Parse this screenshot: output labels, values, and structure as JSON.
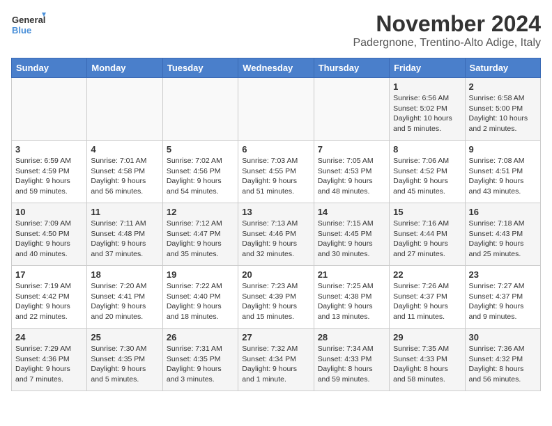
{
  "logo": {
    "line1": "General",
    "line2": "Blue"
  },
  "title": "November 2024",
  "location": "Padergnone, Trentino-Alto Adige, Italy",
  "days_of_week": [
    "Sunday",
    "Monday",
    "Tuesday",
    "Wednesday",
    "Thursday",
    "Friday",
    "Saturday"
  ],
  "weeks": [
    [
      {
        "day": "",
        "info": ""
      },
      {
        "day": "",
        "info": ""
      },
      {
        "day": "",
        "info": ""
      },
      {
        "day": "",
        "info": ""
      },
      {
        "day": "",
        "info": ""
      },
      {
        "day": "1",
        "info": "Sunrise: 6:56 AM\nSunset: 5:02 PM\nDaylight: 10 hours and 5 minutes."
      },
      {
        "day": "2",
        "info": "Sunrise: 6:58 AM\nSunset: 5:00 PM\nDaylight: 10 hours and 2 minutes."
      }
    ],
    [
      {
        "day": "3",
        "info": "Sunrise: 6:59 AM\nSunset: 4:59 PM\nDaylight: 9 hours and 59 minutes."
      },
      {
        "day": "4",
        "info": "Sunrise: 7:01 AM\nSunset: 4:58 PM\nDaylight: 9 hours and 56 minutes."
      },
      {
        "day": "5",
        "info": "Sunrise: 7:02 AM\nSunset: 4:56 PM\nDaylight: 9 hours and 54 minutes."
      },
      {
        "day": "6",
        "info": "Sunrise: 7:03 AM\nSunset: 4:55 PM\nDaylight: 9 hours and 51 minutes."
      },
      {
        "day": "7",
        "info": "Sunrise: 7:05 AM\nSunset: 4:53 PM\nDaylight: 9 hours and 48 minutes."
      },
      {
        "day": "8",
        "info": "Sunrise: 7:06 AM\nSunset: 4:52 PM\nDaylight: 9 hours and 45 minutes."
      },
      {
        "day": "9",
        "info": "Sunrise: 7:08 AM\nSunset: 4:51 PM\nDaylight: 9 hours and 43 minutes."
      }
    ],
    [
      {
        "day": "10",
        "info": "Sunrise: 7:09 AM\nSunset: 4:50 PM\nDaylight: 9 hours and 40 minutes."
      },
      {
        "day": "11",
        "info": "Sunrise: 7:11 AM\nSunset: 4:48 PM\nDaylight: 9 hours and 37 minutes."
      },
      {
        "day": "12",
        "info": "Sunrise: 7:12 AM\nSunset: 4:47 PM\nDaylight: 9 hours and 35 minutes."
      },
      {
        "day": "13",
        "info": "Sunrise: 7:13 AM\nSunset: 4:46 PM\nDaylight: 9 hours and 32 minutes."
      },
      {
        "day": "14",
        "info": "Sunrise: 7:15 AM\nSunset: 4:45 PM\nDaylight: 9 hours and 30 minutes."
      },
      {
        "day": "15",
        "info": "Sunrise: 7:16 AM\nSunset: 4:44 PM\nDaylight: 9 hours and 27 minutes."
      },
      {
        "day": "16",
        "info": "Sunrise: 7:18 AM\nSunset: 4:43 PM\nDaylight: 9 hours and 25 minutes."
      }
    ],
    [
      {
        "day": "17",
        "info": "Sunrise: 7:19 AM\nSunset: 4:42 PM\nDaylight: 9 hours and 22 minutes."
      },
      {
        "day": "18",
        "info": "Sunrise: 7:20 AM\nSunset: 4:41 PM\nDaylight: 9 hours and 20 minutes."
      },
      {
        "day": "19",
        "info": "Sunrise: 7:22 AM\nSunset: 4:40 PM\nDaylight: 9 hours and 18 minutes."
      },
      {
        "day": "20",
        "info": "Sunrise: 7:23 AM\nSunset: 4:39 PM\nDaylight: 9 hours and 15 minutes."
      },
      {
        "day": "21",
        "info": "Sunrise: 7:25 AM\nSunset: 4:38 PM\nDaylight: 9 hours and 13 minutes."
      },
      {
        "day": "22",
        "info": "Sunrise: 7:26 AM\nSunset: 4:37 PM\nDaylight: 9 hours and 11 minutes."
      },
      {
        "day": "23",
        "info": "Sunrise: 7:27 AM\nSunset: 4:37 PM\nDaylight: 9 hours and 9 minutes."
      }
    ],
    [
      {
        "day": "24",
        "info": "Sunrise: 7:29 AM\nSunset: 4:36 PM\nDaylight: 9 hours and 7 minutes."
      },
      {
        "day": "25",
        "info": "Sunrise: 7:30 AM\nSunset: 4:35 PM\nDaylight: 9 hours and 5 minutes."
      },
      {
        "day": "26",
        "info": "Sunrise: 7:31 AM\nSunset: 4:35 PM\nDaylight: 9 hours and 3 minutes."
      },
      {
        "day": "27",
        "info": "Sunrise: 7:32 AM\nSunset: 4:34 PM\nDaylight: 9 hours and 1 minute."
      },
      {
        "day": "28",
        "info": "Sunrise: 7:34 AM\nSunset: 4:33 PM\nDaylight: 8 hours and 59 minutes."
      },
      {
        "day": "29",
        "info": "Sunrise: 7:35 AM\nSunset: 4:33 PM\nDaylight: 8 hours and 58 minutes."
      },
      {
        "day": "30",
        "info": "Sunrise: 7:36 AM\nSunset: 4:32 PM\nDaylight: 8 hours and 56 minutes."
      }
    ]
  ]
}
